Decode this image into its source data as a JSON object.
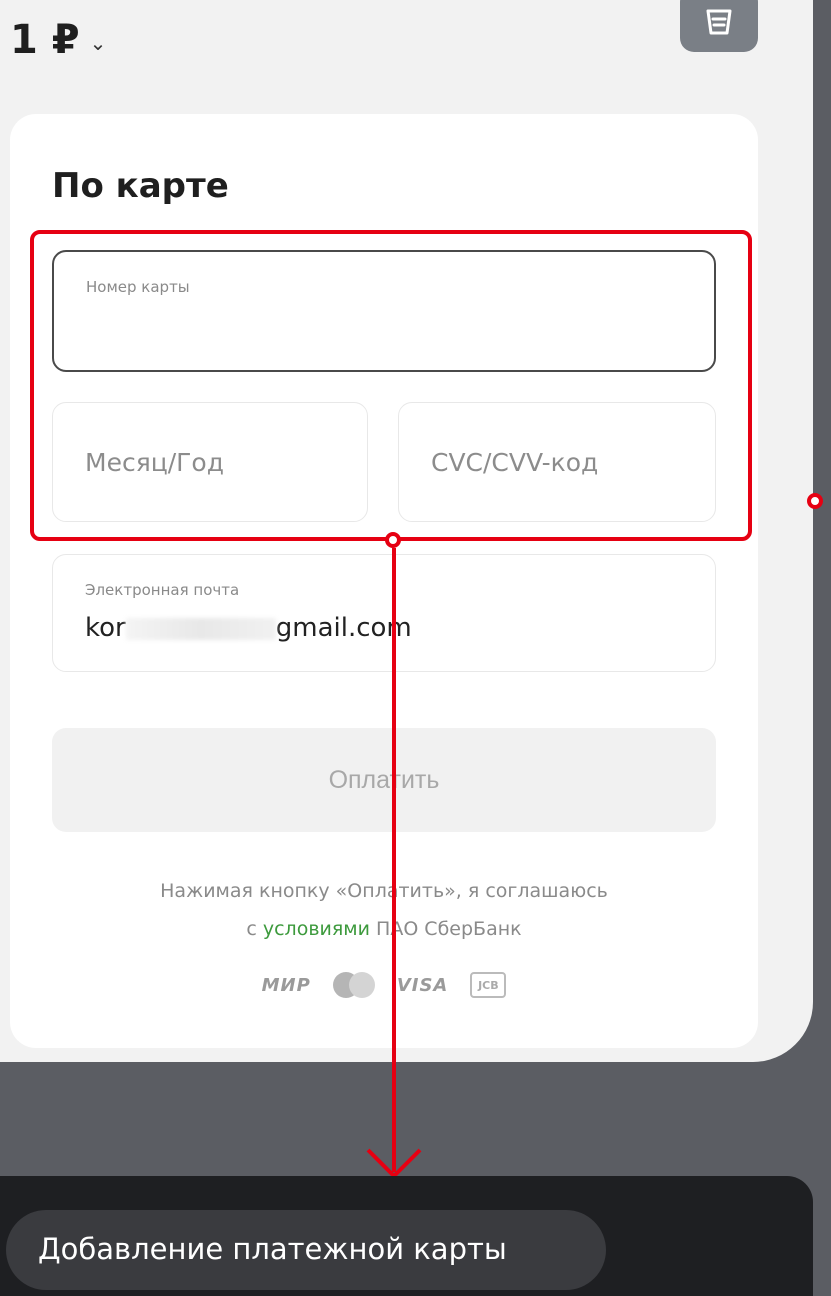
{
  "header": {
    "amount": "1 ₽",
    "amount_dropdown_icon": "chevron-down-icon",
    "trash_icon": "trash-icon"
  },
  "payment_card": {
    "title": "По карте",
    "card_number": {
      "label": "Номер карты",
      "value": ""
    },
    "expiry": {
      "placeholder": "Месяц/Год"
    },
    "cvc": {
      "placeholder": "CVC/CVV-код"
    },
    "email": {
      "label": "Электронная почта",
      "value_prefix": "kor",
      "value_suffix": "gmail.com"
    },
    "pay_button": "Оплатить",
    "terms_line1": "Нажимая кнопку «Оплатить», я соглашаюсь",
    "terms_prefix": "с",
    "terms_link": "условиями",
    "terms_suffix": "ПАО СберБанк",
    "logos": {
      "mir": "МИР",
      "visa": "VISA",
      "mastercard": "mastercard-icon",
      "jcb": "jcb-icon"
    }
  },
  "annotation": {
    "highlight_color": "#e60012"
  },
  "bottom": {
    "caption": "Добавление платежной карты"
  },
  "colors": {
    "link": "#3d9a3d",
    "sheet_bg": "#f2f2f2",
    "backdrop": "#5b5d63"
  }
}
